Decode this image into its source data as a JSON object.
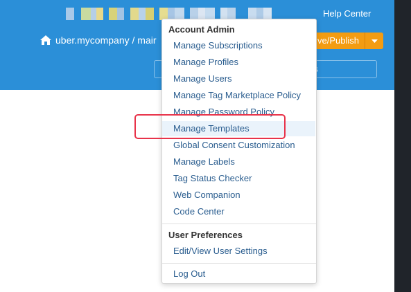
{
  "header": {
    "help_center": "Help Center",
    "breadcrumb_path": "uber.mycompany / mair",
    "publish_label": "ve/Publish",
    "search_partial": "s"
  },
  "menu": {
    "account_admin_heading": "Account Admin",
    "account_items": [
      {
        "label": "Manage Subscriptions"
      },
      {
        "label": "Manage Profiles"
      },
      {
        "label": "Manage Users"
      },
      {
        "label": "Manage Tag Marketplace Policy"
      },
      {
        "label": "Manage Password Policy"
      },
      {
        "label": "Manage Templates"
      },
      {
        "label": "Global Consent Customization"
      },
      {
        "label": "Manage Labels"
      },
      {
        "label": "Tag Status Checker"
      },
      {
        "label": "Web Companion"
      },
      {
        "label": "Code Center"
      }
    ],
    "user_pref_heading": "User Preferences",
    "user_items": [
      {
        "label": "Edit/View User Settings"
      }
    ],
    "logout_label": "Log Out",
    "active_item": "Manage Templates"
  },
  "colors": {
    "header_bg": "#2b8fd8",
    "publish_bg": "#f39c12",
    "link": "#2a5d8f",
    "highlight": "#e8334a"
  },
  "icons": {
    "home": "home-icon",
    "caret": "caret-down-icon"
  }
}
